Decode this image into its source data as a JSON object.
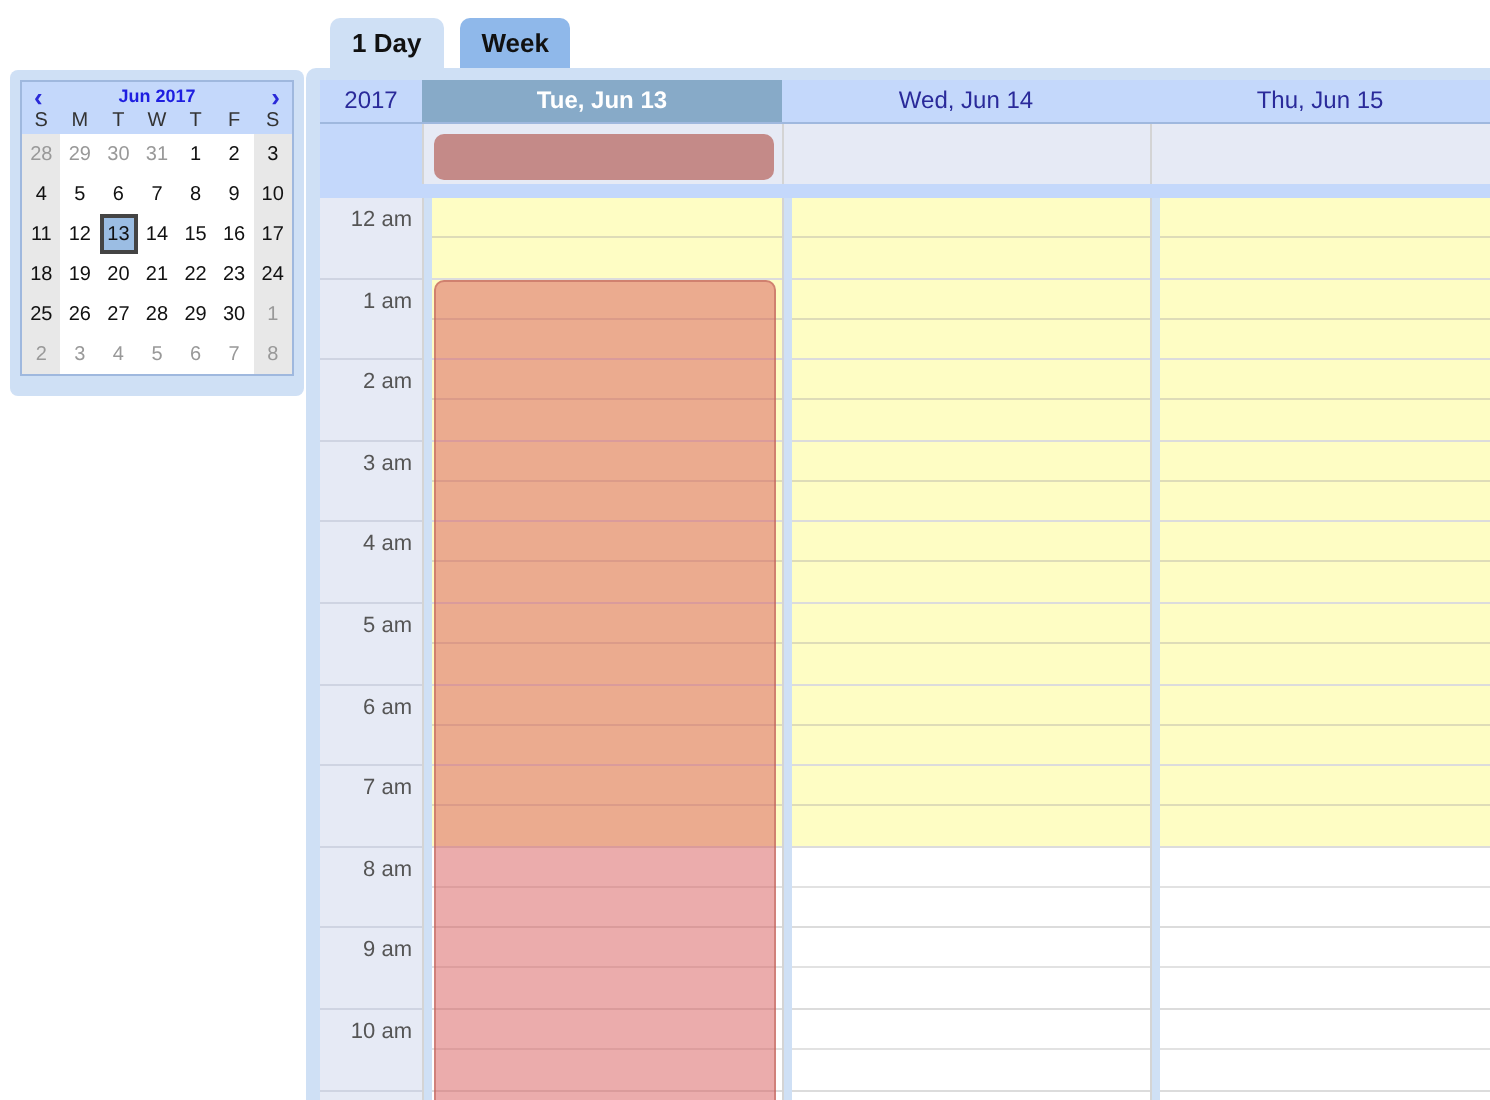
{
  "tabs": [
    {
      "label": "1 Day",
      "selected": true
    },
    {
      "label": "Week",
      "selected": false
    }
  ],
  "mini_calendar": {
    "month": "Jun 2017",
    "prev": "‹",
    "next": "›",
    "weekdays": [
      "S",
      "M",
      "T",
      "W",
      "T",
      "F",
      "S"
    ],
    "weeks": [
      [
        {
          "day": "28",
          "other_month": true,
          "selected": false
        },
        {
          "day": "29",
          "other_month": true,
          "selected": false
        },
        {
          "day": "30",
          "other_month": true,
          "selected": false
        },
        {
          "day": "31",
          "other_month": true,
          "selected": false
        },
        {
          "day": "1",
          "other_month": false,
          "selected": false
        },
        {
          "day": "2",
          "other_month": false,
          "selected": false
        },
        {
          "day": "3",
          "other_month": false,
          "selected": false
        }
      ],
      [
        {
          "day": "4",
          "other_month": false,
          "selected": false
        },
        {
          "day": "5",
          "other_month": false,
          "selected": false
        },
        {
          "day": "6",
          "other_month": false,
          "selected": false
        },
        {
          "day": "7",
          "other_month": false,
          "selected": false
        },
        {
          "day": "8",
          "other_month": false,
          "selected": false
        },
        {
          "day": "9",
          "other_month": false,
          "selected": false
        },
        {
          "day": "10",
          "other_month": false,
          "selected": false
        }
      ],
      [
        {
          "day": "11",
          "other_month": false,
          "selected": false
        },
        {
          "day": "12",
          "other_month": false,
          "selected": false
        },
        {
          "day": "13",
          "other_month": false,
          "selected": true
        },
        {
          "day": "14",
          "other_month": false,
          "selected": false
        },
        {
          "day": "15",
          "other_month": false,
          "selected": false
        },
        {
          "day": "16",
          "other_month": false,
          "selected": false
        },
        {
          "day": "17",
          "other_month": false,
          "selected": false
        }
      ],
      [
        {
          "day": "18",
          "other_month": false,
          "selected": false
        },
        {
          "day": "19",
          "other_month": false,
          "selected": false
        },
        {
          "day": "20",
          "other_month": false,
          "selected": false
        },
        {
          "day": "21",
          "other_month": false,
          "selected": false
        },
        {
          "day": "22",
          "other_month": false,
          "selected": false
        },
        {
          "day": "23",
          "other_month": false,
          "selected": false
        },
        {
          "day": "24",
          "other_month": false,
          "selected": false
        }
      ],
      [
        {
          "day": "25",
          "other_month": false,
          "selected": false
        },
        {
          "day": "26",
          "other_month": false,
          "selected": false
        },
        {
          "day": "27",
          "other_month": false,
          "selected": false
        },
        {
          "day": "28",
          "other_month": false,
          "selected": false
        },
        {
          "day": "29",
          "other_month": false,
          "selected": false
        },
        {
          "day": "30",
          "other_month": false,
          "selected": false
        },
        {
          "day": "1",
          "other_month": true,
          "selected": false
        }
      ],
      [
        {
          "day": "2",
          "other_month": true,
          "selected": false
        },
        {
          "day": "3",
          "other_month": true,
          "selected": false
        },
        {
          "day": "4",
          "other_month": true,
          "selected": false
        },
        {
          "day": "5",
          "other_month": true,
          "selected": false
        },
        {
          "day": "6",
          "other_month": true,
          "selected": false
        },
        {
          "day": "7",
          "other_month": true,
          "selected": false
        },
        {
          "day": "8",
          "other_month": true,
          "selected": false
        }
      ]
    ]
  },
  "scheduler": {
    "year": "2017",
    "days": [
      {
        "label": "Tue, Jun 13",
        "selected": true,
        "all_day_event": true,
        "timed_event": true
      },
      {
        "label": "Wed, Jun 14",
        "selected": false,
        "all_day_event": false,
        "timed_event": false
      },
      {
        "label": "Thu, Jun 15",
        "selected": false,
        "all_day_event": false,
        "timed_event": false
      }
    ],
    "hours": [
      {
        "label": "12 am",
        "highlighted": true,
        "event_start": false
      },
      {
        "label": "1 am",
        "highlighted": true,
        "event_start": true
      },
      {
        "label": "2 am",
        "highlighted": true,
        "event_start": false
      },
      {
        "label": "3 am",
        "highlighted": true,
        "event_start": false
      },
      {
        "label": "4 am",
        "highlighted": true,
        "event_start": false
      },
      {
        "label": "5 am",
        "highlighted": true,
        "event_start": false
      },
      {
        "label": "6 am",
        "highlighted": true,
        "event_start": false
      },
      {
        "label": "7 am",
        "highlighted": true,
        "event_start": false
      },
      {
        "label": "8 am",
        "highlighted": false,
        "event_start": false
      },
      {
        "label": "9 am",
        "highlighted": false,
        "event_start": false
      },
      {
        "label": "10 am",
        "highlighted": false,
        "event_start": false
      }
    ]
  }
}
